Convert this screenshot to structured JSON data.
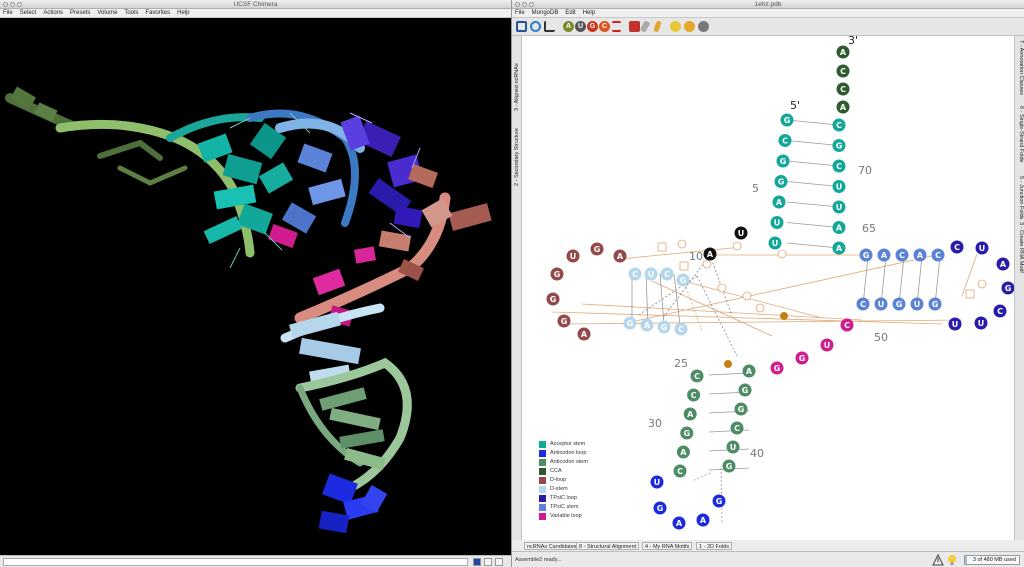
{
  "chimera": {
    "title": "UCSF Chimera",
    "menu": [
      "File",
      "Select",
      "Actions",
      "Presets",
      "Volume",
      "Tools",
      "Favorites",
      "Help"
    ]
  },
  "assemble": {
    "title": "1ehz.pdb",
    "menu": [
      "File",
      "MongoDB",
      "Edit",
      "Help"
    ],
    "left_tabs": [
      "2 - Secondary Structure",
      "3 - Aligned ncRNAs"
    ],
    "right_tabs": [
      "7 - Annotation Classes",
      "6 - Single-Strand Folds",
      "5 - Junction Folds",
      "3 - Create RNA Motif"
    ],
    "bottom_tabs": [
      "ncRNAs Candidates",
      "8 - Structural Alignment",
      "4 - My RNA Motifs",
      "1 - 2D Folds"
    ],
    "status": "Assemble2 ready...",
    "memory": "3 of 480 MB used",
    "memory_fraction": 0.04,
    "toolbar_letters": [
      "A",
      "U",
      "G",
      "C"
    ],
    "end_labels": {
      "three_prime": "3'",
      "five_prime": "5'"
    },
    "position_labels": [
      "70",
      "5",
      "65",
      "10",
      "50",
      "25",
      "30",
      "40"
    ],
    "legend": [
      {
        "label": "Acceptor stem",
        "color": "#11a89a"
      },
      {
        "label": "Anticodon loop",
        "color": "#1c2be0"
      },
      {
        "label": "Anticodon stem",
        "color": "#4e8c66"
      },
      {
        "label": "CCA",
        "color": "#2f5a2e"
      },
      {
        "label": "D-loop",
        "color": "#944848"
      },
      {
        "label": "D-stem",
        "color": "#b6d6ec"
      },
      {
        "label": "TPsiC loop",
        "color": "#2a1caa"
      },
      {
        "label": "TPsiC stem",
        "color": "#5a82d6"
      },
      {
        "label": "Variable loop",
        "color": "#d01c8e"
      }
    ],
    "nucleotides": {
      "cca": [
        "A",
        "C",
        "C",
        "A"
      ],
      "acceptor_5": [
        "G",
        "C",
        "G",
        "G",
        "A",
        "U",
        "U"
      ],
      "acceptor_3": [
        "C",
        "G",
        "C",
        "U",
        "U",
        "A",
        "A"
      ],
      "u8": "U",
      "a9": "A",
      "d_loop": [
        "A",
        "G",
        "U",
        "G",
        "G",
        "G",
        "A"
      ],
      "d_stem_top": [
        "C",
        "U",
        "C",
        "G"
      ],
      "d_stem_bottom": [
        "G",
        "A",
        "G",
        "C"
      ],
      "tpsic_stem_top": [
        "G",
        "A",
        "C",
        "A",
        "C"
      ],
      "tpsic_stem_bottom": [
        "C",
        "U",
        "G",
        "U",
        "G"
      ],
      "tpsic_loop": [
        "C",
        "U",
        "A",
        "G",
        "C",
        "U",
        "U"
      ],
      "variable_loop": [
        "C",
        "U",
        "G",
        "G"
      ],
      "anticodon_stem_5": [
        "C",
        "C",
        "A",
        "G",
        "A",
        "C"
      ],
      "anticodon_stem_3": [
        "A",
        "G",
        "G",
        "C",
        "U",
        "G"
      ],
      "anticodon_loop": [
        "U",
        "G",
        "A",
        "A",
        "G"
      ]
    }
  }
}
